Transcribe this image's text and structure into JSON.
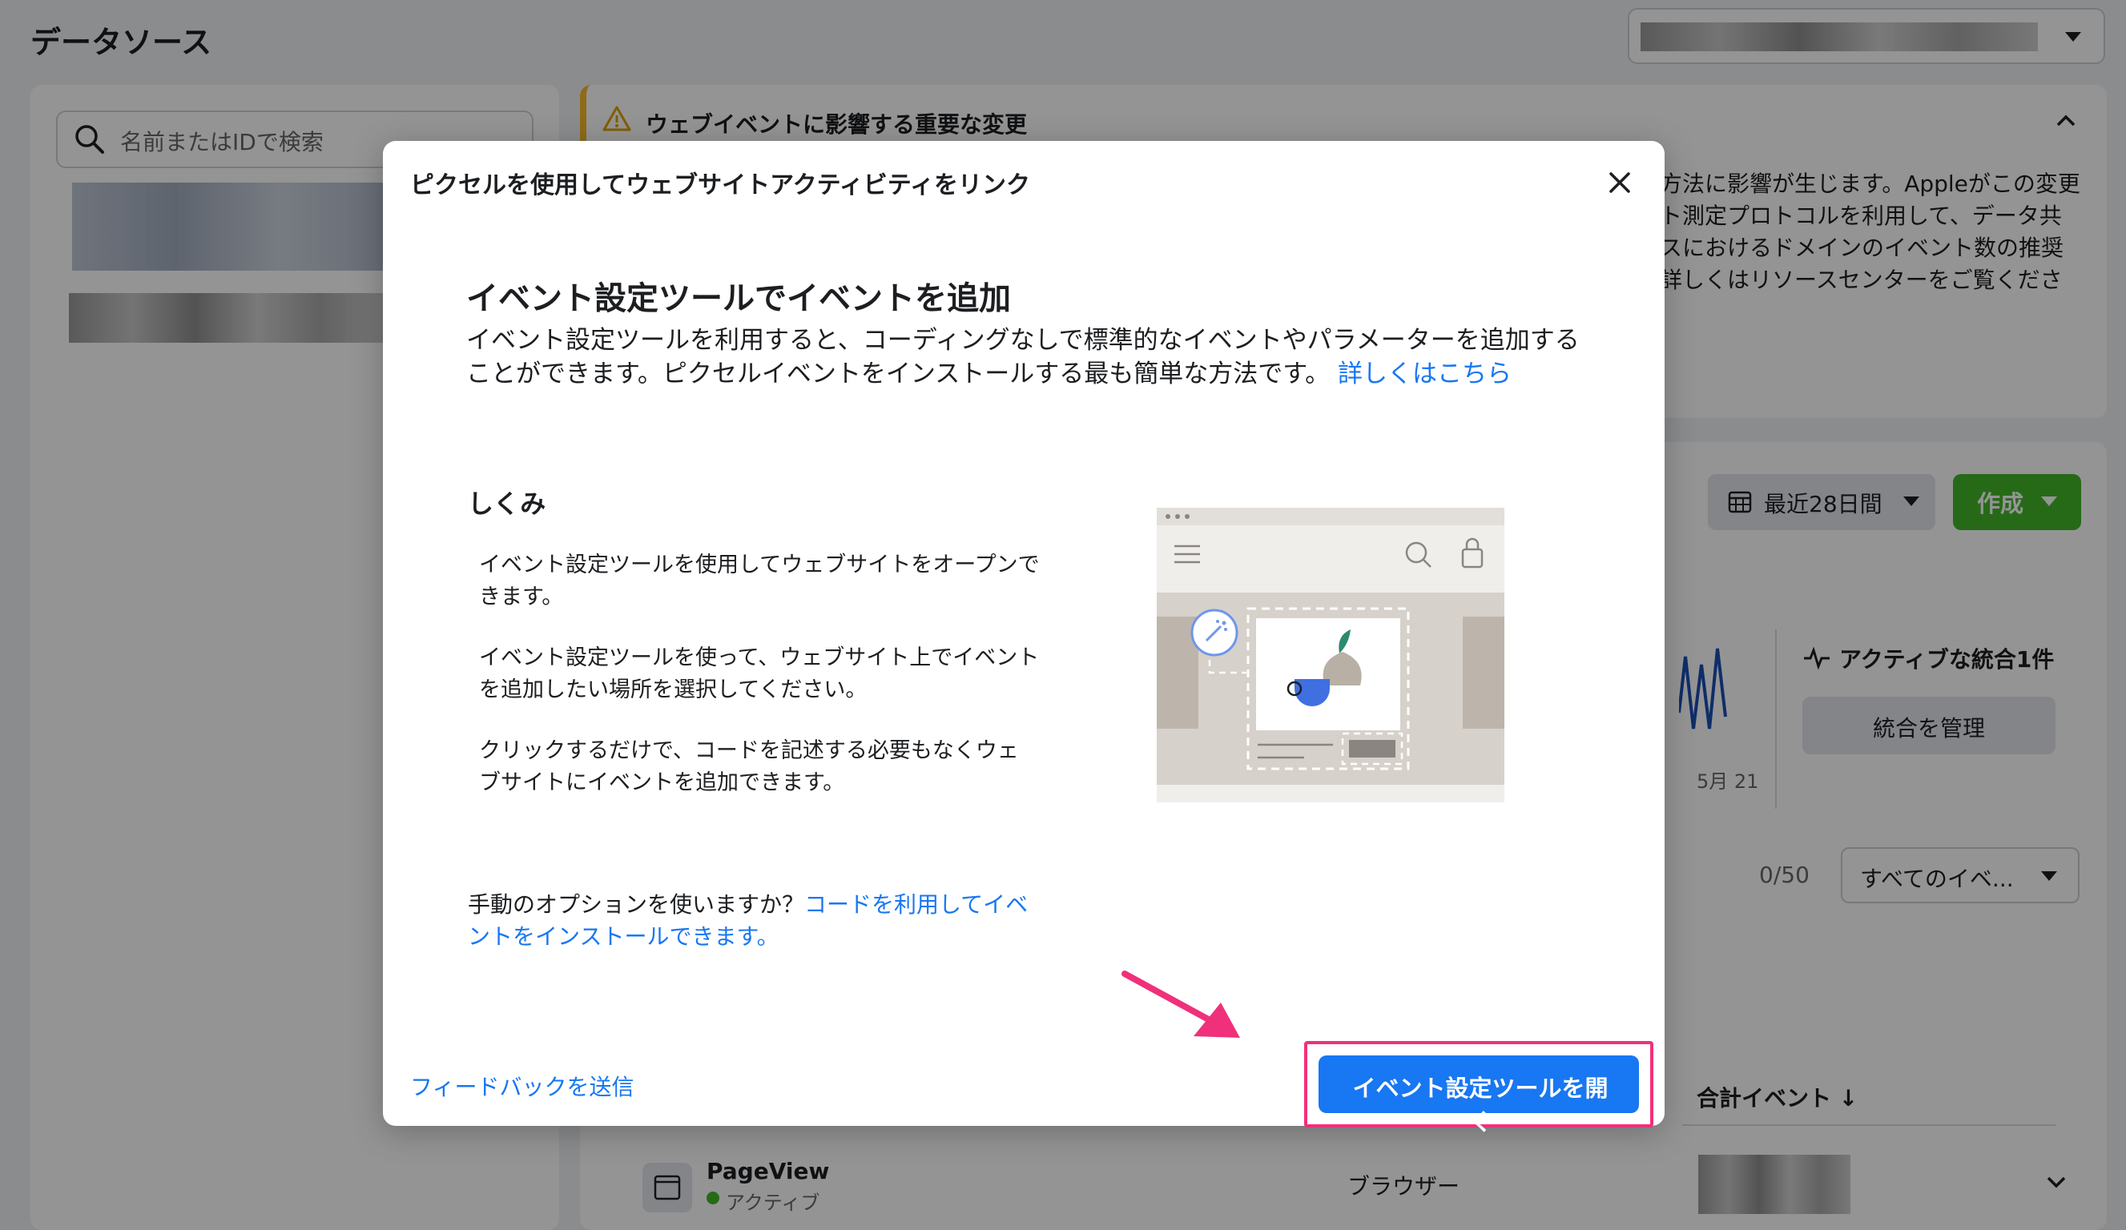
{
  "page": {
    "title": "データソース",
    "search_placeholder": "名前またはIDで検索"
  },
  "notice": {
    "title": "ウェブイベントに影響する重要な変更",
    "lines": [
      "方法に影響が生じます。Appleがこの変更",
      "ト測定プロトコルを利用して、データ共",
      "スにおけるドメインのイベント数の推奨",
      "詳しくはリソースセンターをご覧くださ"
    ]
  },
  "main": {
    "date_range": "最近28日間",
    "create_button": "作成",
    "active_integration": "アクティブな統合1件",
    "manage_integration": "統合を管理",
    "chart_month": "5月 21",
    "count": "0/50",
    "event_filter": "すべてのイベ...",
    "total_events_header": "合計イベント ↓",
    "row": {
      "name": "PageView",
      "status": "アクティブ",
      "type": "ブラウザー"
    }
  },
  "modal": {
    "title": "ピクセルを使用してウェブサイトアクティビティをリンク",
    "heading": "イベント設定ツールでイベントを追加",
    "lead": "イベント設定ツールを利用すると、コーディングなしで標準的なイベントやパラメーターを追加することができます。ピクセルイベントをインストールする最も簡単な方法です。",
    "lead_link": "詳しくはこちら",
    "how_heading": "しくみ",
    "steps": [
      "イベント設定ツールを使用してウェブサイトをオープンできます。",
      "イベント設定ツールを使って、ウェブサイト上でイベントを追加したい場所を選択してください。",
      "クリックするだけで、コードを記述する必要もなくウェブサイトにイベントを追加できます。"
    ],
    "manual_text": "手動のオプションを使いますか？",
    "manual_link": "コードを利用してイベントをインストールできます。",
    "feedback": "フィードバックを送信",
    "open_button": "イベント設定ツールを開く"
  },
  "colors": {
    "primary": "#1877f2",
    "create_green": "#42b72a",
    "highlight": "#f0307a",
    "warning": "#f7b928"
  }
}
